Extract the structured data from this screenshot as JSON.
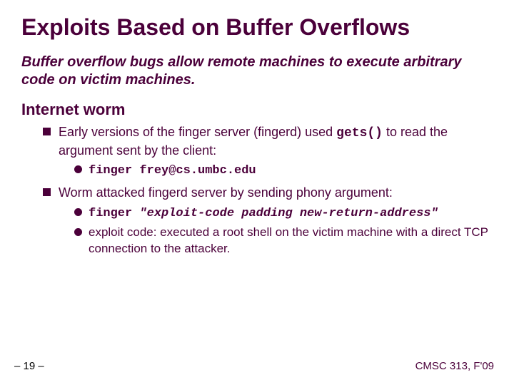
{
  "title": "Exploits Based on Buffer Overflows",
  "intro": "Buffer overflow bugs allow remote machines to execute arbitrary code on victim machines.",
  "subhead": "Internet worm",
  "b1_pre": "Early versions of the finger server (fingerd) used ",
  "b1_code": "gets()",
  "b1_post": " to read the argument sent by the client:",
  "b1a": "finger frey@cs.umbc.edu",
  "b2": "Worm attacked fingerd server by sending phony argument:",
  "b2a_cmd": "finger ",
  "b2a_arg": "\"exploit-code  padding  new-return-address\"",
  "b2b": "exploit code: executed a root shell on the victim machine with a direct TCP connection to the attacker.",
  "footer_left": "– 19 –",
  "footer_right": "CMSC 313, F'09"
}
